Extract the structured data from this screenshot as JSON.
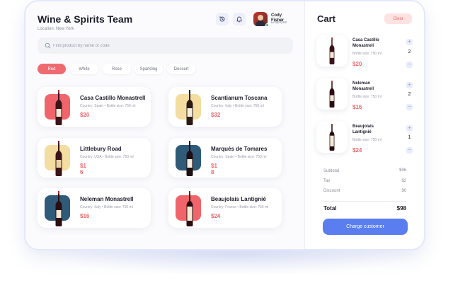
{
  "header": {
    "title": "Wine & Spirits Team",
    "location": "Location: New York",
    "user": {
      "name": "Cody Fisher",
      "role": "Employee"
    }
  },
  "search": {
    "placeholder": "Find product by name or code",
    "value": ""
  },
  "filters": [
    {
      "label": "Red",
      "active": true
    },
    {
      "label": "White",
      "active": false
    },
    {
      "label": "Rose",
      "active": false
    },
    {
      "label": "Sparkling",
      "active": false
    },
    {
      "label": "Dessert",
      "active": false
    }
  ],
  "products": [
    {
      "name": "Casa Castillo Monastrell",
      "meta": "Country: Spain • Bottle size: 750 ml",
      "price": "$20",
      "thumb_color": "#f0656b"
    },
    {
      "name": "Scantianum Toscana",
      "meta": "Country: Italy • Bottle size: 750 ml",
      "price": "$32",
      "thumb_color": "#f3dda0"
    },
    {
      "name": "Littlebury Road",
      "meta": "Country: USA • Bottle size: 750 ml",
      "price": "$16",
      "thumb_color": "#f3dda0"
    },
    {
      "name": "Marqués de Tomares",
      "meta": "Country: Spain • Bottle size: 750 ml",
      "price": "$18",
      "thumb_color": "#2f5a78"
    },
    {
      "name": "Neleman Monastrell",
      "meta": "Country: Italy • Bottle size: 750 ml",
      "price": "$16",
      "thumb_color": "#2f5a78"
    },
    {
      "name": "Beaujolais Lantignié",
      "meta": "Country: France • Bottle size: 750 ml",
      "price": "$24",
      "thumb_color": "#f0656b"
    }
  ],
  "cart": {
    "title": "Cart",
    "clear_label": "Clear",
    "items": [
      {
        "name": "Casa Castillo Monastrell",
        "meta": "Bottle size: 750 ml",
        "price": "$20",
        "qty": "2"
      },
      {
        "name": "Neleman Monastrell",
        "meta": "Bottle size: 750 ml",
        "price": "$16",
        "qty": "2"
      },
      {
        "name": "Beaujolais Lantignié",
        "meta": "Bottle size: 750 ml",
        "price": "$24",
        "qty": "1"
      }
    ],
    "summary": {
      "subtotal_label": "Subtotal",
      "subtotal": "$96",
      "tax_label": "Tax",
      "tax": "$2",
      "discount_label": "Discount",
      "discount": "$0",
      "total_label": "Total",
      "total": "$98"
    },
    "charge_label": "Charge customer"
  },
  "colors": {
    "accent": "#ee6a6f",
    "primary": "#5a7ef0"
  },
  "icons": [
    "history-icon",
    "bell-icon",
    "search-icon",
    "plus-icon",
    "minus-icon",
    "wine-bottle-icon"
  ]
}
